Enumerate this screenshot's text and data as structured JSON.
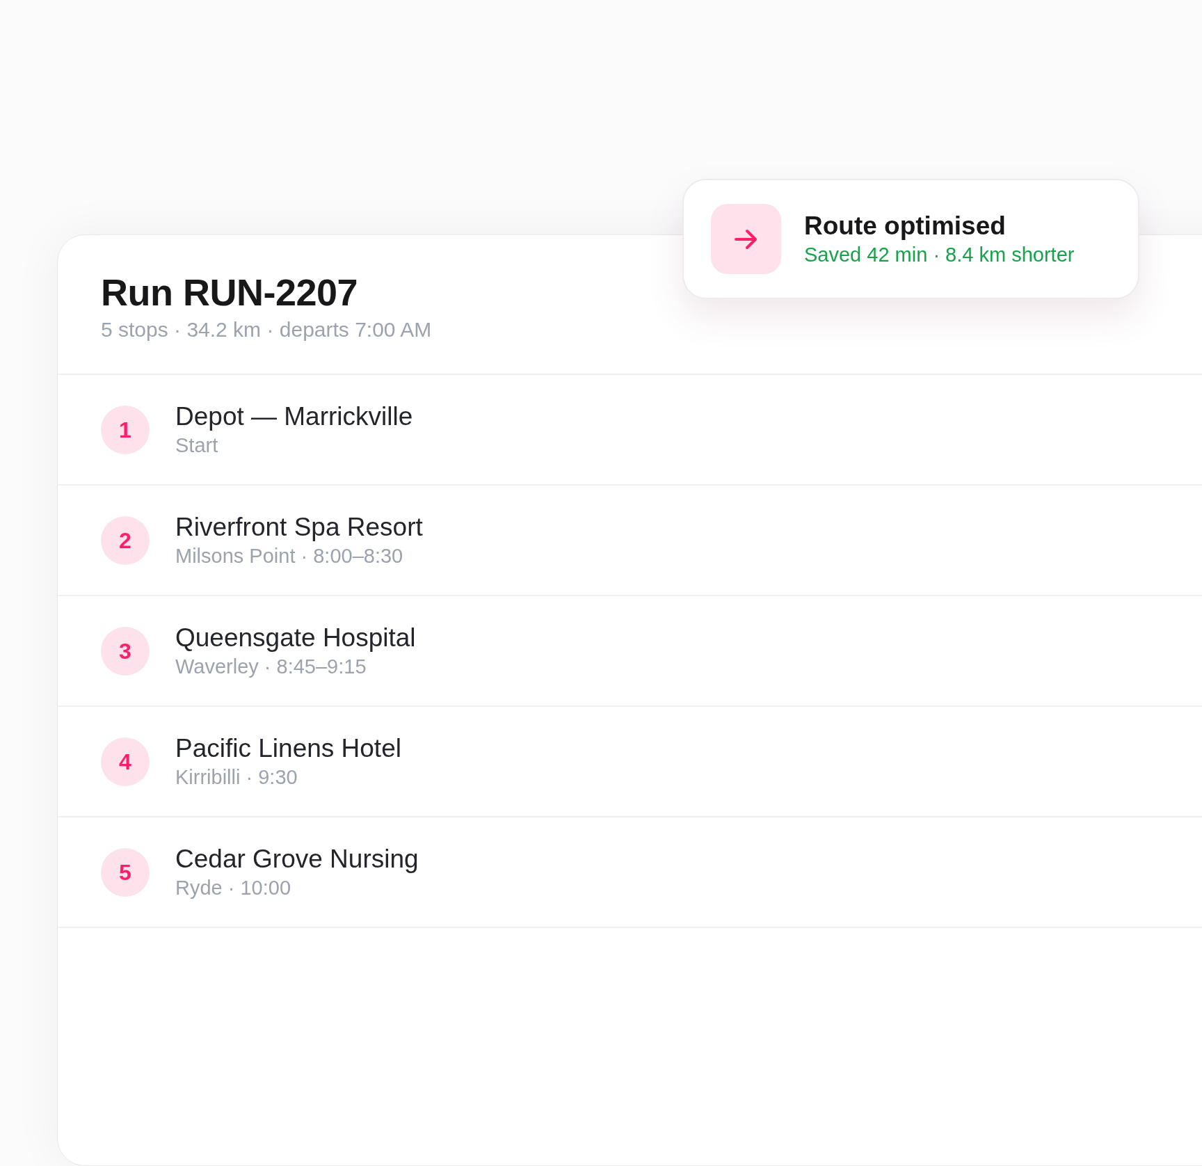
{
  "run": {
    "title": "Run RUN-2207",
    "summary": "5 stops · 34.2 km · departs 7:00 AM"
  },
  "stops": [
    {
      "number": "1",
      "name": "Depot — Marrickville",
      "detail": "Start"
    },
    {
      "number": "2",
      "name": "Riverfront Spa Resort",
      "detail": "Milsons Point · 8:00–8:30"
    },
    {
      "number": "3",
      "name": "Queensgate Hospital",
      "detail": "Waverley · 8:45–9:15"
    },
    {
      "number": "4",
      "name": "Pacific Linens Hotel",
      "detail": "Kirribilli · 9:30"
    },
    {
      "number": "5",
      "name": "Cedar Grove Nursing",
      "detail": "Ryde · 10:00"
    }
  ],
  "toast": {
    "title": "Route optimised",
    "detail": "Saved 42 min · 8.4 km shorter"
  }
}
